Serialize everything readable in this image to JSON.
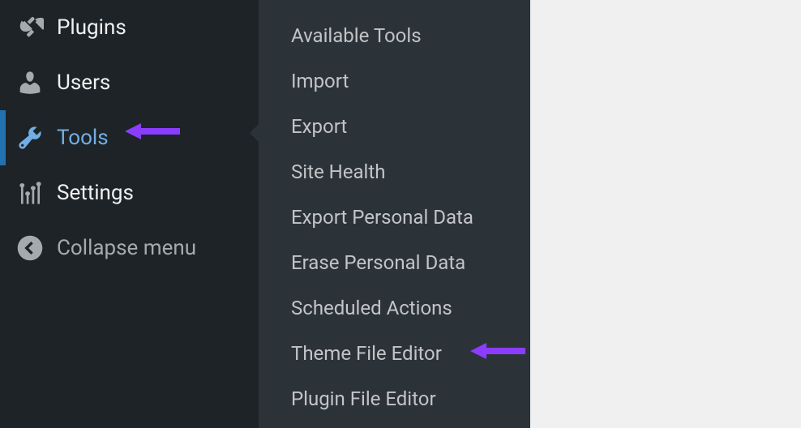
{
  "sidebar": {
    "items": [
      {
        "label": "Plugins",
        "icon": "plugin"
      },
      {
        "label": "Users",
        "icon": "user"
      },
      {
        "label": "Tools",
        "icon": "wrench",
        "active": true
      },
      {
        "label": "Settings",
        "icon": "sliders"
      },
      {
        "label": "Collapse menu",
        "icon": "collapse"
      }
    ]
  },
  "submenu": {
    "items": [
      {
        "label": "Available Tools"
      },
      {
        "label": "Import"
      },
      {
        "label": "Export"
      },
      {
        "label": "Site Health"
      },
      {
        "label": "Export Personal Data"
      },
      {
        "label": "Erase Personal Data"
      },
      {
        "label": "Scheduled Actions"
      },
      {
        "label": "Theme File Editor"
      },
      {
        "label": "Plugin File Editor"
      }
    ]
  },
  "annotations": {
    "arrow_color": "#8b3dff"
  }
}
